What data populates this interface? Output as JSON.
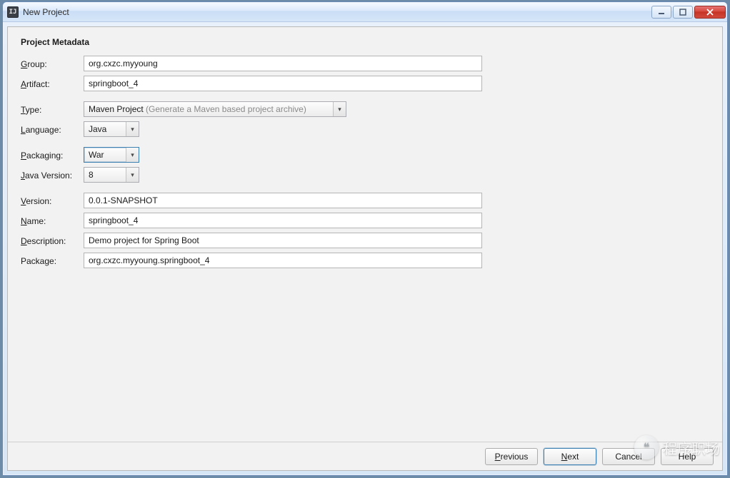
{
  "window": {
    "title": "New Project",
    "icon_label": "IJ"
  },
  "section_title": "Project Metadata",
  "labels": {
    "group": "Group:",
    "artifact": "Artifact:",
    "type": "Type:",
    "language": "Language:",
    "packaging": "Packaging:",
    "java_version": "Java Version:",
    "version": "Version:",
    "name": "Name:",
    "description": "Description:",
    "package": "Package:"
  },
  "mnemonics": {
    "group": "G",
    "artifact": "A",
    "type": "T",
    "language": "L",
    "packaging": "P",
    "java_version": "J",
    "version": "V",
    "name": "N",
    "description": "D",
    "package": "g"
  },
  "fields": {
    "group": "org.cxzc.myyoung",
    "artifact": "springboot_4",
    "type": {
      "value": "Maven Project",
      "hint": "(Generate a Maven based project archive)"
    },
    "language": "Java",
    "packaging": "War",
    "java_version": "8",
    "version": "0.0.1-SNAPSHOT",
    "name": "springboot_4",
    "description": "Demo project for Spring Boot",
    "package": "org.cxzc.myyoung.springboot_4"
  },
  "buttons": {
    "previous": "Previous",
    "next": "Next",
    "cancel": "Cancel",
    "help": "Help"
  },
  "watermark": {
    "text": "程序职场"
  }
}
